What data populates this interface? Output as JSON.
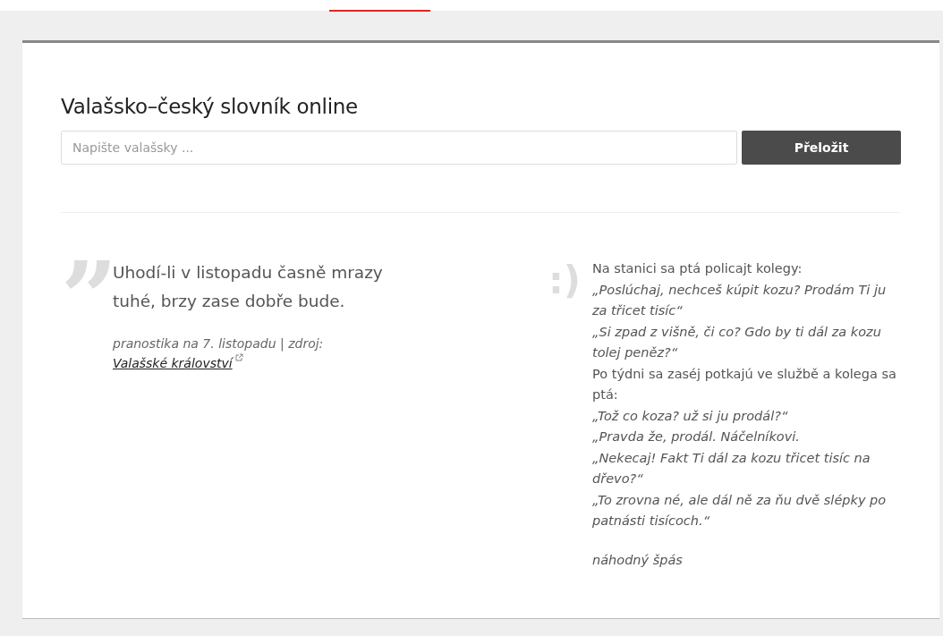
{
  "title": "Valašsko–český slovník online",
  "search": {
    "placeholder": "Napište valašsky ...",
    "button": "Přeložit"
  },
  "saying": {
    "mark": "”",
    "text": "Uhodí-li v listopadu časně mrazy tuhé, brzy zase dobře bude.",
    "source": "pranostika na 7. listopadu | zdroj:",
    "link": "Valašské království",
    "external": true
  },
  "joke": {
    "mark": ":)",
    "lines": [
      {
        "kind": "narration",
        "text": "Na stanici sa ptá policajt kolegy:"
      },
      {
        "kind": "speech",
        "text": "„Poslúchaj, nechceš kúpit kozu? Prodám Ti ju za třicet tisíc“"
      },
      {
        "kind": "speech",
        "text": "„Si zpad z višně, či co? Gdo by ti dál za kozu tolej peněz?“"
      },
      {
        "kind": "narration",
        "text": "Po týdni sa zaséj potkajú ve službě a kolega sa ptá:"
      },
      {
        "kind": "speech",
        "text": "„Tož co koza? už si ju prodál?“"
      },
      {
        "kind": "speech",
        "text": "„Pravda že, prodál. Náčelníkovi."
      },
      {
        "kind": "speech",
        "text": "„Nekecaj! Fakt Ti dál za kozu třicet tisíc na dřevo?“"
      },
      {
        "kind": "speech",
        "text": "„To zrovna né, ale dál ně za ňu dvě slépky po patnásti tisícoch.“"
      }
    ],
    "caption": "náhodný špás"
  }
}
